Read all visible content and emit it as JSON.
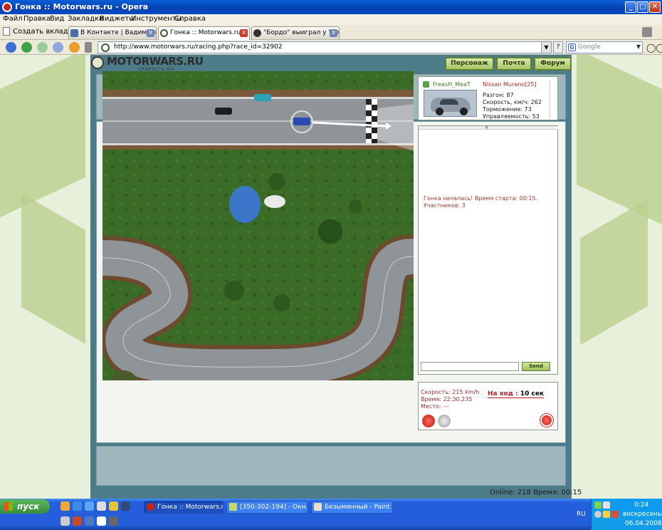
{
  "window": {
    "title": "Гонка :: Motorwars.ru - Opera"
  },
  "menu": [
    "Файл",
    "Правка",
    "Вид",
    "Закладки",
    "Виджеты",
    "Инструменты",
    "Справка"
  ],
  "tabs": {
    "new_tab": "Создать вкладку",
    "items": [
      {
        "label": "В Контакте | Вадим Саз..."
      },
      {
        "label": "Гонка :: Motorwars.ru"
      },
      {
        "label": "\"Бордо\" выиграл у \"Рен..."
      }
    ]
  },
  "address": {
    "url": "http://www.motorwars.ru/racing.php?race_id=32902",
    "search_placeholder": "Google"
  },
  "site": {
    "logo": "MOTORWARS.RU",
    "logo_sub": "СКОРОСТЬ ОН-ЛАЙН",
    "nav": [
      "Персонаж",
      "Почта",
      "Форум"
    ],
    "online": "Online: 218  Время: 00:15"
  },
  "player": {
    "name": "FreasH_MeaT",
    "car": "Nissan Murano[25]",
    "stats": [
      "Разгон: 87",
      "Скорость, км/ч: 262",
      "Торможение: 73",
      "Управляемость: 53"
    ]
  },
  "chat": {
    "messages": [
      "Гонка началась! Время старта: 00:15.",
      "Участников: 3"
    ],
    "send": "Send"
  },
  "race": {
    "speed": "Скорость: 215 km/h",
    "time": "Время: 22:30.235",
    "place": "Место: ---",
    "turn_label": "На ход :",
    "turn_value": "10 сек"
  },
  "taskbar": {
    "start": "пуск",
    "items": [
      {
        "label": "Гонка :: Motorwars.r..."
      },
      {
        "label": "[350-302-194] - Окн..."
      },
      {
        "label": "Безымянный - Paint"
      }
    ],
    "lang": "RU",
    "time": "0:24",
    "day": "воскресенье",
    "date": "06.04.2008"
  },
  "colors": {
    "accent": "#245edb",
    "site_green": "#a8c667",
    "site_teal": "#4d7c88"
  }
}
